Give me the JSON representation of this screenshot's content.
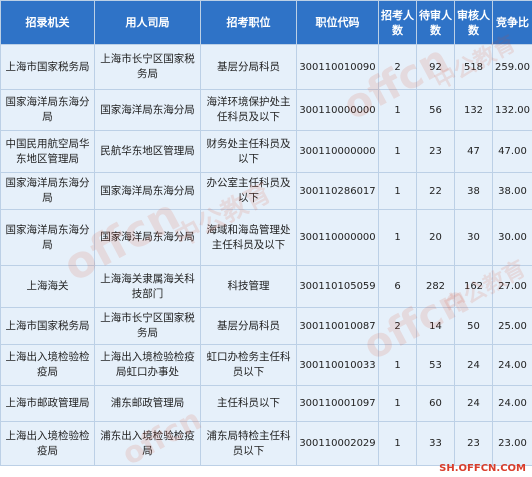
{
  "headers": {
    "agency": "招录机关",
    "employer": "用人司局",
    "position": "招考职位",
    "code": "职位代码",
    "recruit": "招考人数",
    "pending": "待审人数",
    "approved": "审核人数",
    "ratio": "竞争比"
  },
  "rows": [
    {
      "agency": "上海市国家税务局",
      "employer": "上海市长宁区国家税务局",
      "position": "基层分局科员",
      "code": "300110010090",
      "recruit": "2",
      "pending": "92",
      "approved": "518",
      "ratio": "259.00"
    },
    {
      "agency": "国家海洋局东海分局",
      "employer": "国家海洋局东海分局",
      "position": "海洋环境保护处主任科员及以下",
      "code": "300110000000",
      "recruit": "1",
      "pending": "56",
      "approved": "132",
      "ratio": "132.00"
    },
    {
      "agency": "中国民用航空局华东地区管理局",
      "employer": "民航华东地区管理局",
      "position": "财务处主任科员及以下",
      "code": "300110000000",
      "recruit": "1",
      "pending": "23",
      "approved": "47",
      "ratio": "47.00"
    },
    {
      "agency": "国家海洋局东海分局",
      "employer": "国家海洋局东海分局",
      "position": "办公室主任科员及以下",
      "code": "300110286017",
      "recruit": "1",
      "pending": "22",
      "approved": "38",
      "ratio": "38.00"
    },
    {
      "agency": "国家海洋局东海分局",
      "employer": "国家海洋局东海分局",
      "position": "海域和海岛管理处主任科员及以下",
      "code": "300110000000",
      "recruit": "1",
      "pending": "20",
      "approved": "30",
      "ratio": "30.00"
    },
    {
      "agency": "上海海关",
      "employer": "上海海关隶属海关科技部门",
      "position": "科技管理",
      "code": "300110105059",
      "recruit": "6",
      "pending": "282",
      "approved": "162",
      "ratio": "27.00"
    },
    {
      "agency": "上海市国家税务局",
      "employer": "上海市长宁区国家税务局",
      "position": "基层分局科员",
      "code": "300110010087",
      "recruit": "2",
      "pending": "14",
      "approved": "50",
      "ratio": "25.00"
    },
    {
      "agency": "上海出入境检验检疫局",
      "employer": "上海出入境检验检疫局虹口办事处",
      "position": "虹口办检务主任科员以下",
      "code": "300110010033",
      "recruit": "1",
      "pending": "53",
      "approved": "24",
      "ratio": "24.00"
    },
    {
      "agency": "上海市邮政管理局",
      "employer": "浦东邮政管理局",
      "position": "主任科员以下",
      "code": "300110001097",
      "recruit": "1",
      "pending": "60",
      "approved": "24",
      "ratio": "24.00"
    },
    {
      "agency": "上海出入境检验检疫局",
      "employer": "浦东出入境检验检疫局",
      "position": "浦东局特检主任科员以下",
      "code": "300110002029",
      "recruit": "1",
      "pending": "33",
      "approved": "23",
      "ratio": "23.00"
    }
  ],
  "watermark": {
    "brand": "offcn",
    "text": "中公教育"
  },
  "footer_url": "SH.OFFCN.COM"
}
